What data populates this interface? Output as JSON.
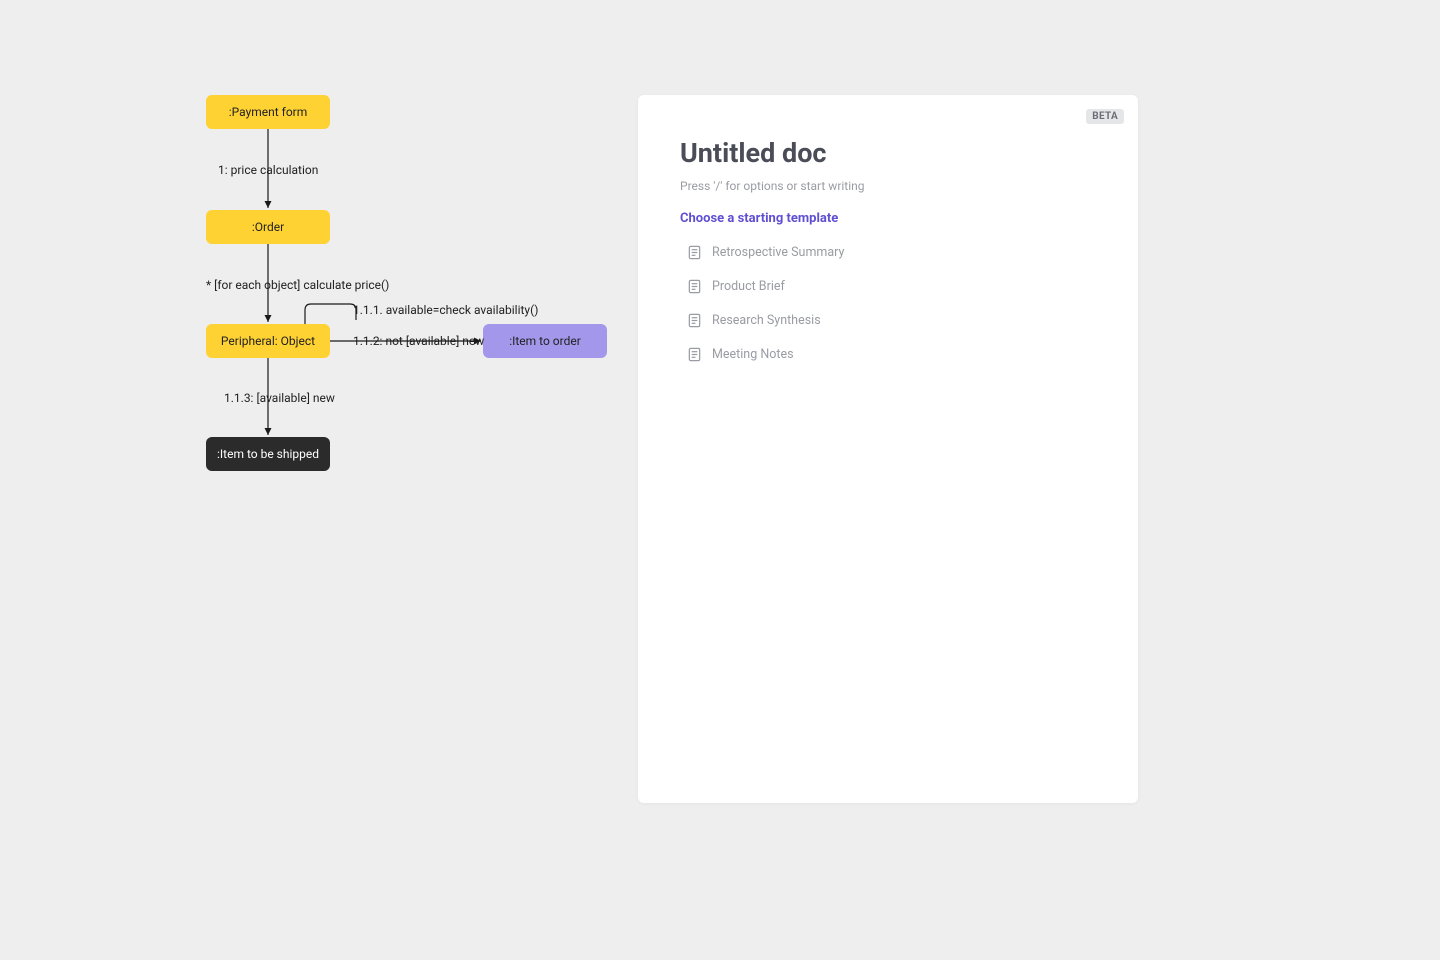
{
  "diagram": {
    "nodes": {
      "payment_form": ":Payment form",
      "order": ":Order",
      "peripheral": "Peripheral: Object",
      "item_to_order": ":Item to order",
      "item_to_ship": ":Item to be shipped"
    },
    "edges": {
      "e1": "1: price calculation",
      "e2": "* [for each object] calculate price()",
      "e3": "1.1.1. available=check availability()",
      "e4": "1.1.2: not [available] new",
      "e5": "1.1.3: [available] new"
    }
  },
  "doc": {
    "badge": "BETA",
    "title": "Untitled doc",
    "hint": "Press '/' for options or start writing",
    "section": "Choose a starting template",
    "templates": [
      {
        "label": "Retrospective Summary"
      },
      {
        "label": "Product Brief"
      },
      {
        "label": "Research Synthesis"
      },
      {
        "label": "Meeting Notes"
      }
    ]
  }
}
